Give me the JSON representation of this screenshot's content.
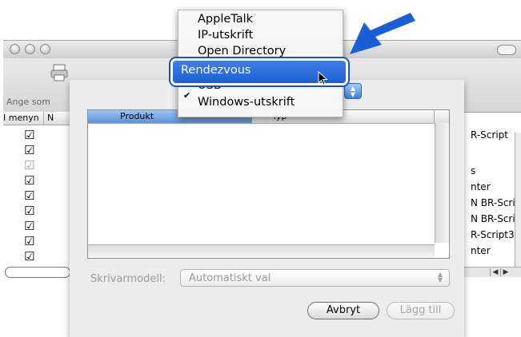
{
  "window": {
    "toolbar_label": "Ange som",
    "column_header": {
      "in_menu": "I menyn",
      "name_initial": "N"
    },
    "right_column_items": [
      "R-Script",
      "s",
      "nter",
      "N BR-Scri",
      "N BR-Scri",
      "R-Script3",
      "nter"
    ]
  },
  "sheet": {
    "list": {
      "column_product": "Produkt",
      "column_type": "Typ"
    },
    "model_label": "Skrivarmodell:",
    "model_value": "Automatiskt val",
    "buttons": {
      "cancel": "Avbryt",
      "add": "Lägg till"
    }
  },
  "connection_menu": {
    "items": [
      "AppleTalk",
      "IP-utskrift",
      "Open Directory",
      "Rendezvous",
      "USB",
      "Windows-utskrift"
    ],
    "selected": "Rendezvous",
    "checked": "USB"
  },
  "colors": {
    "highlight": "#1d5fd0",
    "callout_arrow": "#1a5fd6"
  }
}
